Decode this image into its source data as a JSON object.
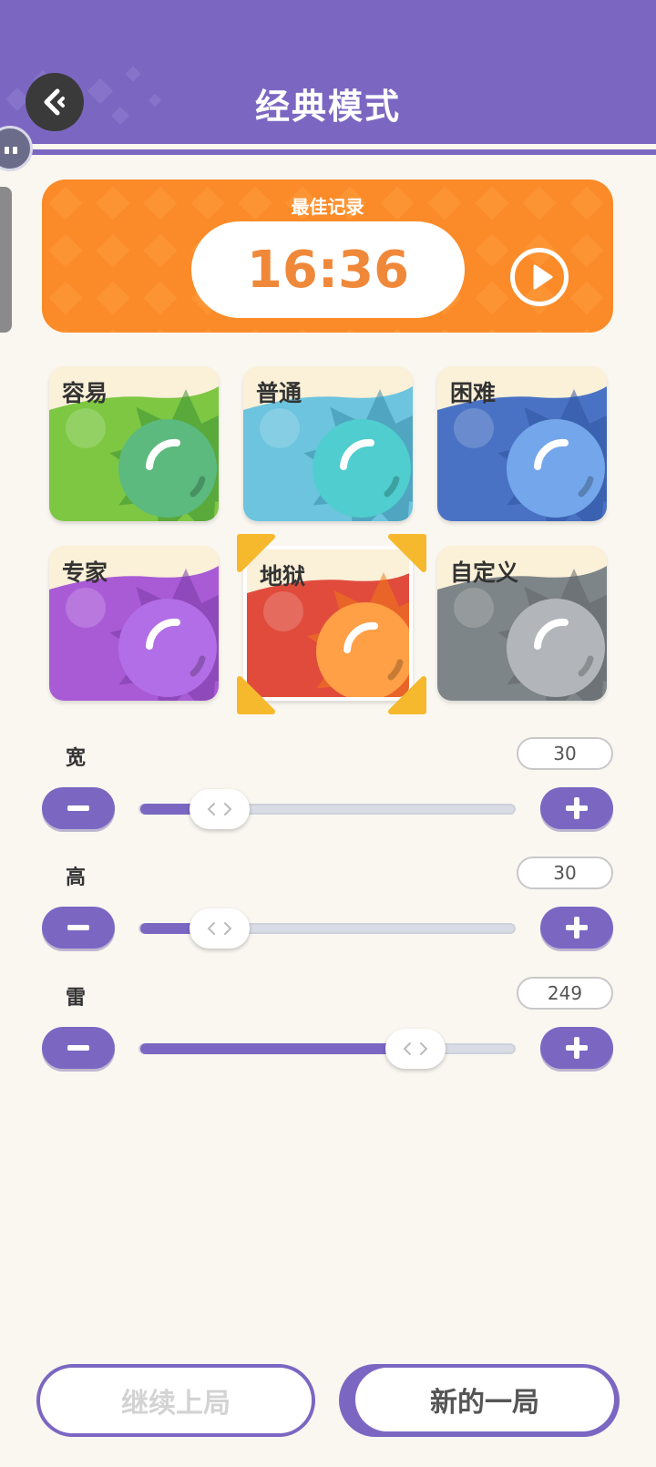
{
  "header": {
    "title": "经典模式"
  },
  "best": {
    "label": "最佳记录",
    "time": "16:36"
  },
  "difficulties": [
    {
      "label": "容易",
      "selected": false,
      "bg": "#7dc743",
      "sun": "#5cba7e",
      "spike": "#3c8f35"
    },
    {
      "label": "普通",
      "selected": false,
      "bg": "#6cc4de",
      "sun": "#4fcdcf",
      "spike": "#3a8ea8"
    },
    {
      "label": "困难",
      "selected": false,
      "bg": "#4a72c4",
      "sun": "#73a6ea",
      "spike": "#2f56a0"
    },
    {
      "label": "专家",
      "selected": false,
      "bg": "#a95bd6",
      "sun": "#b26ee6",
      "spike": "#7a3aa6"
    },
    {
      "label": "地狱",
      "selected": true,
      "bg": "#e04b3c",
      "sun": "#ff9f46",
      "spike": "#f07a18"
    },
    {
      "label": "自定义",
      "selected": false,
      "bg": "#7e8588",
      "sun": "#b2b6ba",
      "spike": "#5f6568"
    }
  ],
  "sliders": [
    {
      "label": "宽",
      "value": "30",
      "fraction": 0.16
    },
    {
      "label": "高",
      "value": "30",
      "fraction": 0.16
    },
    {
      "label": "雷",
      "value": "249",
      "fraction": 0.78
    }
  ],
  "buttons": {
    "continue": "继续上局",
    "new_game": "新的一局"
  },
  "colors": {
    "accent": "#7b67c2",
    "orange": "#fb8b28",
    "background": "#faf7f1"
  }
}
